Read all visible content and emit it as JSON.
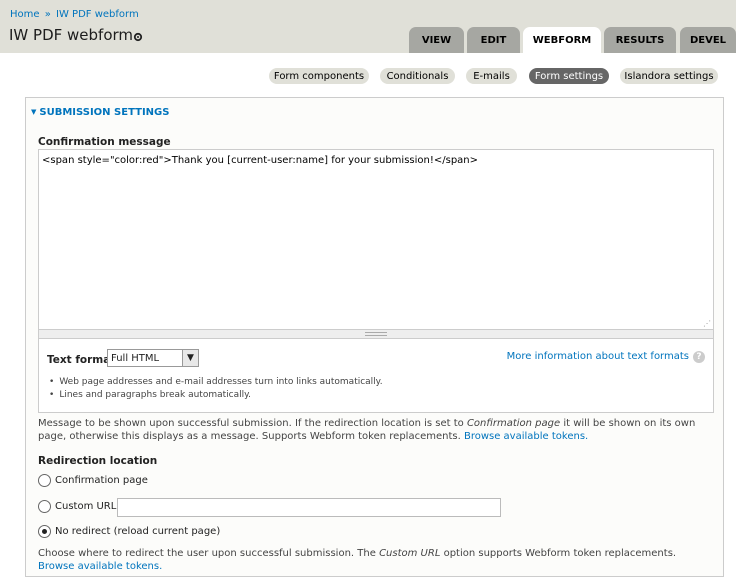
{
  "breadcrumb": {
    "home": "Home",
    "separator": "»",
    "current": "IW PDF webform"
  },
  "page_title": "IW PDF webform",
  "tabs": [
    {
      "label": "View",
      "active": false
    },
    {
      "label": "Edit",
      "active": false
    },
    {
      "label": "Webform",
      "active": true
    },
    {
      "label": "Results",
      "active": false
    },
    {
      "label": "Devel",
      "active": false
    }
  ],
  "subtabs": [
    {
      "label": "Form components",
      "active": false
    },
    {
      "label": "Conditionals",
      "active": false
    },
    {
      "label": "E-mails",
      "active": false
    },
    {
      "label": "Form settings",
      "active": true
    },
    {
      "label": "Islandora settings",
      "active": false
    }
  ],
  "fieldset": {
    "legend": "Submission settings",
    "confirmation": {
      "label": "Confirmation message",
      "value": "<span style=\"color:red\">Thank you [current-user:name] for your submission!</span>"
    },
    "text_format": {
      "label": "Text format",
      "selected": "Full HTML",
      "more_info": "More information about text formats",
      "tips": [
        "Web page addresses and e-mail addresses turn into links automatically.",
        "Lines and paragraphs break automatically."
      ]
    },
    "confirmation_desc": {
      "part1": "Message to be shown upon successful submission. If the redirection location is set to ",
      "em": "Confirmation page",
      "part2": " it will be shown on its own page, otherwise this displays as a message. Supports Webform token replacements. ",
      "link": "Browse available tokens."
    },
    "redirection": {
      "label": "Redirection location",
      "options": [
        {
          "label": "Confirmation page",
          "checked": false
        },
        {
          "label": "Custom URL:",
          "checked": false
        },
        {
          "label": "No redirect (reload current page)",
          "checked": true
        }
      ],
      "custom_url_value": "",
      "desc_part1": "Choose where to redirect the user upon successful submission. The ",
      "desc_em": "Custom URL",
      "desc_part2": " option supports Webform token replacements. ",
      "desc_link": "Browse available tokens."
    }
  }
}
